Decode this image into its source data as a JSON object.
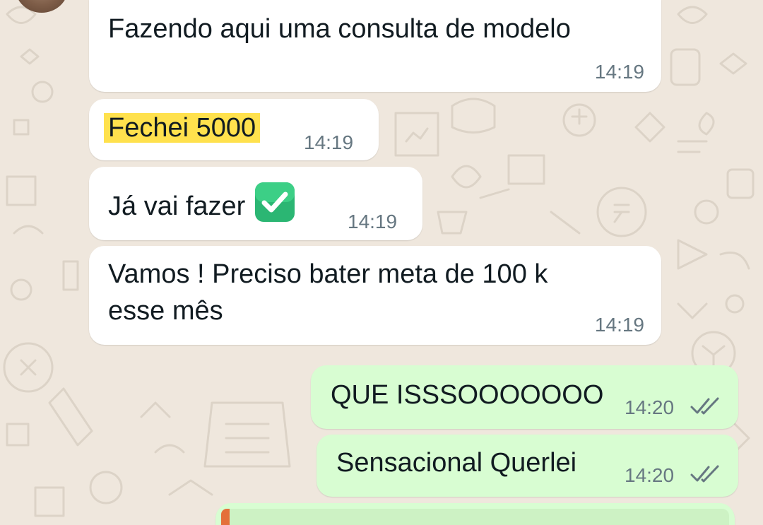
{
  "colors": {
    "wallpaper": "#efe7dd",
    "incoming_bubble": "#ffffff",
    "outgoing_bubble": "#d8fdd2",
    "highlight": "#ffe14d",
    "time_text": "#667781",
    "ticks": "#667781",
    "check_emoji": "#2bb673"
  },
  "messages": [
    {
      "direction": "incoming",
      "text": "Fazendo aqui uma consulta de modelo",
      "time": "14:19"
    },
    {
      "direction": "incoming",
      "text": "Fechei 5000",
      "time": "14:19",
      "highlighted": true
    },
    {
      "direction": "incoming",
      "text": "Já vai fazer",
      "emoji": "check-mark-button",
      "time": "14:19"
    },
    {
      "direction": "incoming",
      "text_line1": "Vamos ! Preciso bater meta de 100 k",
      "text_line2": "esse mês",
      "time": "14:19"
    },
    {
      "direction": "outgoing",
      "text": "QUE ISSSOOOOOOO",
      "time": "14:20",
      "status": "delivered"
    },
    {
      "direction": "outgoing",
      "text": "Sensacional Querlei",
      "time": "14:20",
      "status": "delivered"
    }
  ]
}
